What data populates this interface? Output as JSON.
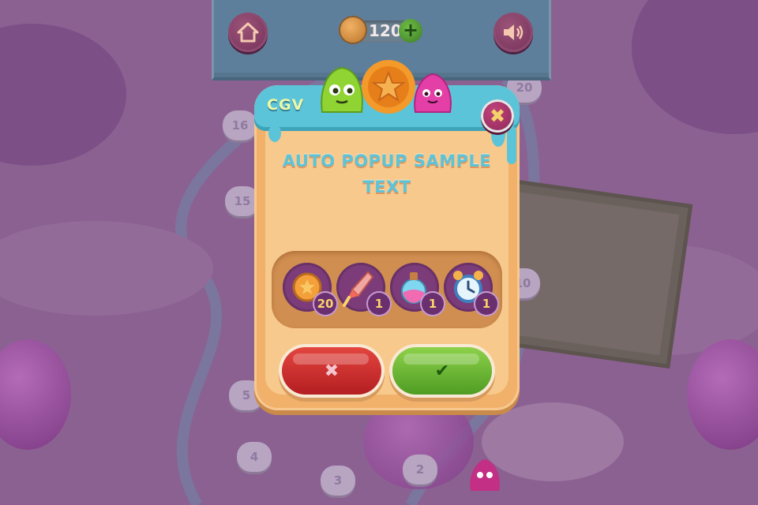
{
  "topbar": {
    "coins": "120",
    "plus": "+",
    "home_icon": "home-icon",
    "sound_icon": "sound-icon"
  },
  "map": {
    "levels": [
      "20",
      "16",
      "15",
      "10",
      "5",
      "4",
      "3",
      "2"
    ]
  },
  "popup": {
    "brand": "CGV",
    "title_line1": "AUTO POPUP SAMPLE",
    "title_line2": "TEXT",
    "close": "✖",
    "rewards": [
      {
        "icon": "coin-icon",
        "count": "20"
      },
      {
        "icon": "rocket-icon",
        "count": "1"
      },
      {
        "icon": "potion-icon",
        "count": "1"
      },
      {
        "icon": "alarm-clock-icon",
        "count": "1"
      }
    ],
    "cancel": "✖",
    "confirm": "✔"
  },
  "colors": {
    "popup": "#f1b16a",
    "header": "#5cc4d9",
    "cancel": "#d8302f",
    "confirm": "#6fbe3a",
    "background": "#8a5f91"
  }
}
